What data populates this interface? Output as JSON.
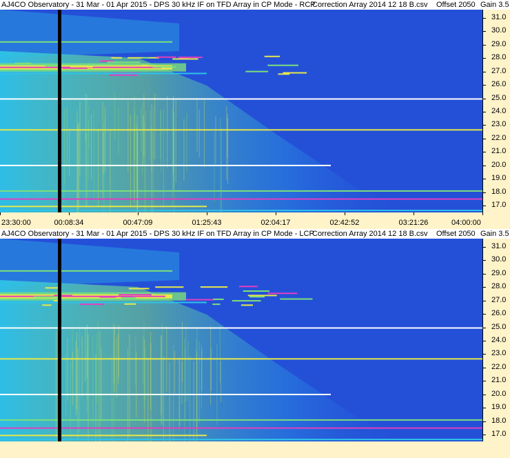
{
  "chart_data": [
    {
      "type": "heatmap",
      "title": {
        "observatory": "AJ4CO Observatory - 31 Mar - 01 Apr 2015 - DPS 30 kHz IF on TFD Array in CP Mode - RCP",
        "correction": "Correction Array 2014 12 18 B.csv",
        "offset": "Offset 2050",
        "gain": "Gain 3.5"
      },
      "yticks": [
        "31.0",
        "30.0",
        "29.0",
        "28.0",
        "27.0",
        "26.0",
        "25.0",
        "24.0",
        "23.0",
        "22.0",
        "21.0",
        "20.0",
        "19.0",
        "18.0",
        "17.0"
      ],
      "ylim": [
        16.5,
        31.6
      ],
      "xticks": [
        "23:30:00",
        "00:08:34",
        "00:47:09",
        "01:25:43",
        "02:04:17",
        "02:42:52",
        "03:21:26",
        "04:00:00"
      ],
      "xlim": [
        "23:30:00",
        "04:00:00"
      ],
      "marker_time": "00:03:00"
    },
    {
      "type": "heatmap",
      "title": {
        "observatory": "AJ4CO Observatory - 31 Mar - 01 Apr 2015 - DPS 30 kHz IF on TFD Array in CP Mode - LCP",
        "correction": "Correction Array 2014 12 18 B.csv",
        "offset": "Offset 2050",
        "gain": "Gain 3.5"
      },
      "yticks": [
        "31.0",
        "30.0",
        "29.0",
        "28.0",
        "27.0",
        "26.0",
        "25.0",
        "24.0",
        "23.0",
        "22.0",
        "21.0",
        "20.0",
        "19.0",
        "18.0",
        "17.0"
      ],
      "ylim": [
        16.5,
        31.6
      ],
      "xticks": [],
      "xlim": [
        "23:30:00",
        "04:00:00"
      ],
      "marker_time": "00:03:00"
    }
  ],
  "colors": {
    "background": "#2450d8",
    "cyan": "#2ec3e8",
    "green": "#7de07a",
    "yellow": "#e8e84a",
    "magenta": "#e040c0",
    "white": "#ffffff"
  }
}
